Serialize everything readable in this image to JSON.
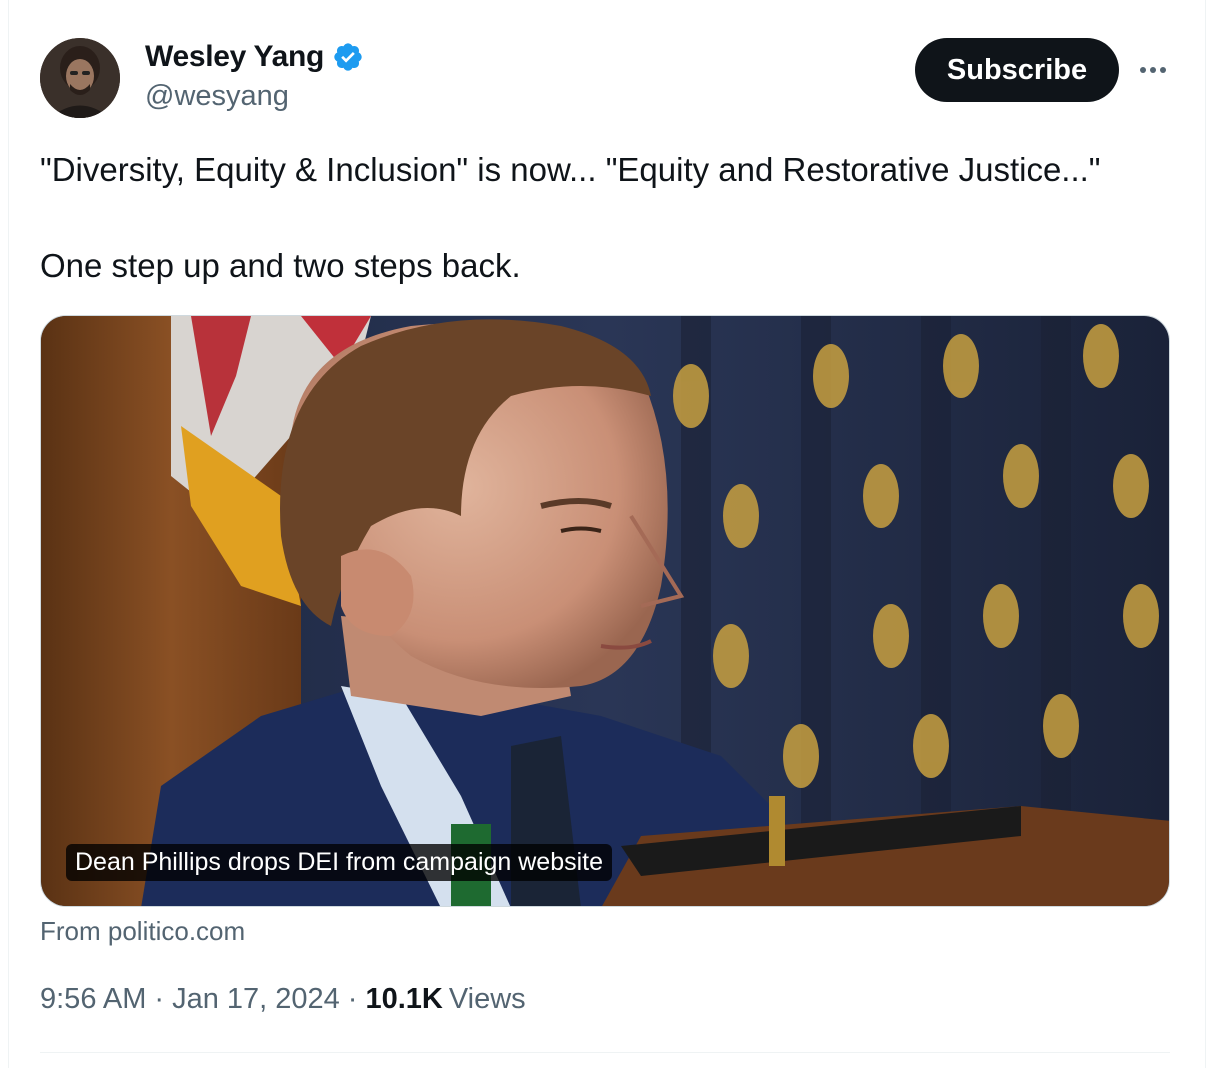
{
  "author": {
    "display_name": "Wesley Yang",
    "handle": "@wesyang",
    "verified_icon": "verified-badge-icon",
    "verified_color": "#1d9bf0"
  },
  "actions": {
    "subscribe_label": "Subscribe",
    "more_icon": "more-horizontal-icon"
  },
  "tweet": {
    "line1": "\"Diversity, Equity & Inclusion\" is now... \"Equity and Restorative Justice...\"",
    "line2": "One step up and two steps back."
  },
  "media": {
    "caption": "Dean Phillips drops DEI from campaign website",
    "source": "From politico.com"
  },
  "meta": {
    "time": "9:56 AM",
    "date": "Jan 17, 2024",
    "views_count": "10.1K",
    "views_label": "Views"
  },
  "colors": {
    "text_primary": "#0f1419",
    "text_secondary": "#536471",
    "button_bg": "#0f1419",
    "border": "#cfd9de"
  }
}
